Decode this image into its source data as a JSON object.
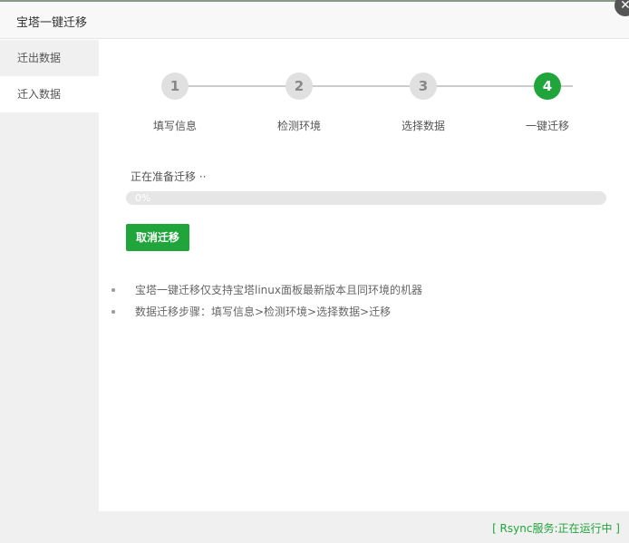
{
  "window": {
    "title": "宝塔一键迁移",
    "close_icon": "close-icon"
  },
  "sidebar": {
    "items": [
      {
        "label": "迁出数据",
        "active": false
      },
      {
        "label": "迁入数据",
        "active": true
      }
    ]
  },
  "steps": [
    {
      "number": "1",
      "label": "填写信息",
      "active": false
    },
    {
      "number": "2",
      "label": "检测环境",
      "active": false
    },
    {
      "number": "3",
      "label": "选择数据",
      "active": false
    },
    {
      "number": "4",
      "label": "一键迁移",
      "active": true
    }
  ],
  "migration": {
    "status_text": "正在准备迁移 ··",
    "progress_percent": 0,
    "progress_label": "0%",
    "cancel_label": "取消迁移"
  },
  "notes": [
    "宝塔一键迁移仅支持宝塔linux面板最新版本且同环境的机器",
    "数据迁移步骤：填写信息>检测环境>选择数据>迁移"
  ],
  "footer": {
    "status": "[ Rsync服务:正在运行中 ]"
  },
  "colors": {
    "accent": "#20a53a",
    "inactive_step": "#e0e0e0"
  }
}
